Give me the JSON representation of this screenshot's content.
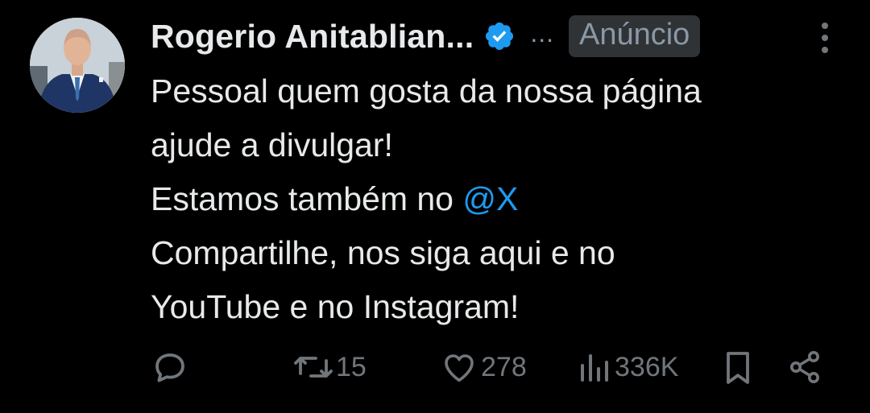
{
  "post": {
    "author_name": "Rogerio Anitablian...",
    "more_label": "...",
    "ad_label": "Anúncio",
    "text": {
      "line1": "Pessoal quem gosta da nossa página",
      "line2": "ajude a divulgar!",
      "line3_prefix": "Estamos também no ",
      "line3_mention": "@X",
      "line4": "Compartilhe, nos siga aqui e no",
      "line5": "YouTube e no Instagram!"
    },
    "actions": {
      "reposts": "15",
      "likes": "278",
      "views": "336K"
    }
  },
  "colors": {
    "background": "#000000",
    "text": "#e7e9ea",
    "muted": "#71767b",
    "link": "#1d9bf0",
    "verified": "#1d9bf0",
    "badge_bg": "#2f3336"
  },
  "icons": [
    "verified-badge-icon",
    "kebab-menu-icon",
    "reply-icon",
    "repost-icon",
    "like-icon",
    "views-icon",
    "bookmark-icon",
    "share-icon"
  ]
}
